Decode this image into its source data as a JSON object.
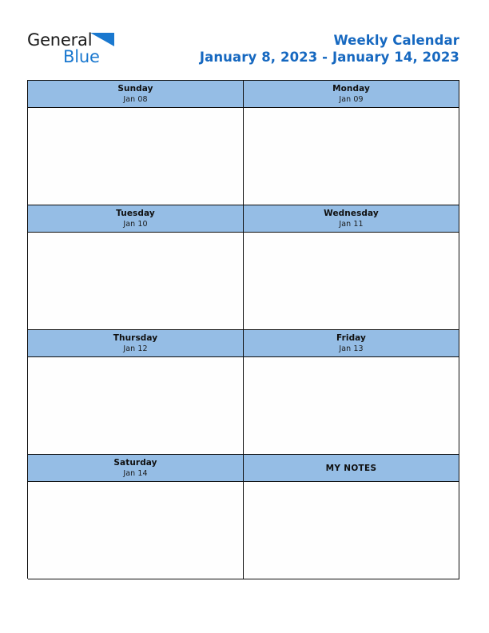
{
  "document": {
    "type": "weekly-calendar-printable"
  },
  "brand": {
    "name_part1": "General",
    "name_part2": "Blue",
    "mark": "triangle-icon",
    "color_dark": "#1a1a1a",
    "color_blue": "#1a78cf"
  },
  "header": {
    "title": "Weekly Calendar",
    "date_range": "January 8, 2023 - January 14, 2023",
    "title_color": "#1668c0"
  },
  "theme": {
    "header_cell_bg": "#95bde5",
    "body_cell_bg": "#fefefe",
    "border_color": "#0d0d0d"
  },
  "weeks": [
    {
      "left": {
        "day": "Sunday",
        "date": "Jan 08",
        "note": ""
      },
      "right": {
        "day": "Monday",
        "date": "Jan 09",
        "note": ""
      }
    },
    {
      "left": {
        "day": "Tuesday",
        "date": "Jan 10",
        "note": ""
      },
      "right": {
        "day": "Wednesday",
        "date": "Jan 11",
        "note": ""
      }
    },
    {
      "left": {
        "day": "Thursday",
        "date": "Jan 12",
        "note": ""
      },
      "right": {
        "day": "Friday",
        "date": "Jan 13",
        "note": ""
      }
    },
    {
      "left": {
        "day": "Saturday",
        "date": "Jan 14",
        "note": ""
      },
      "right": {
        "day": "MY NOTES",
        "date": "",
        "note": ""
      }
    }
  ]
}
